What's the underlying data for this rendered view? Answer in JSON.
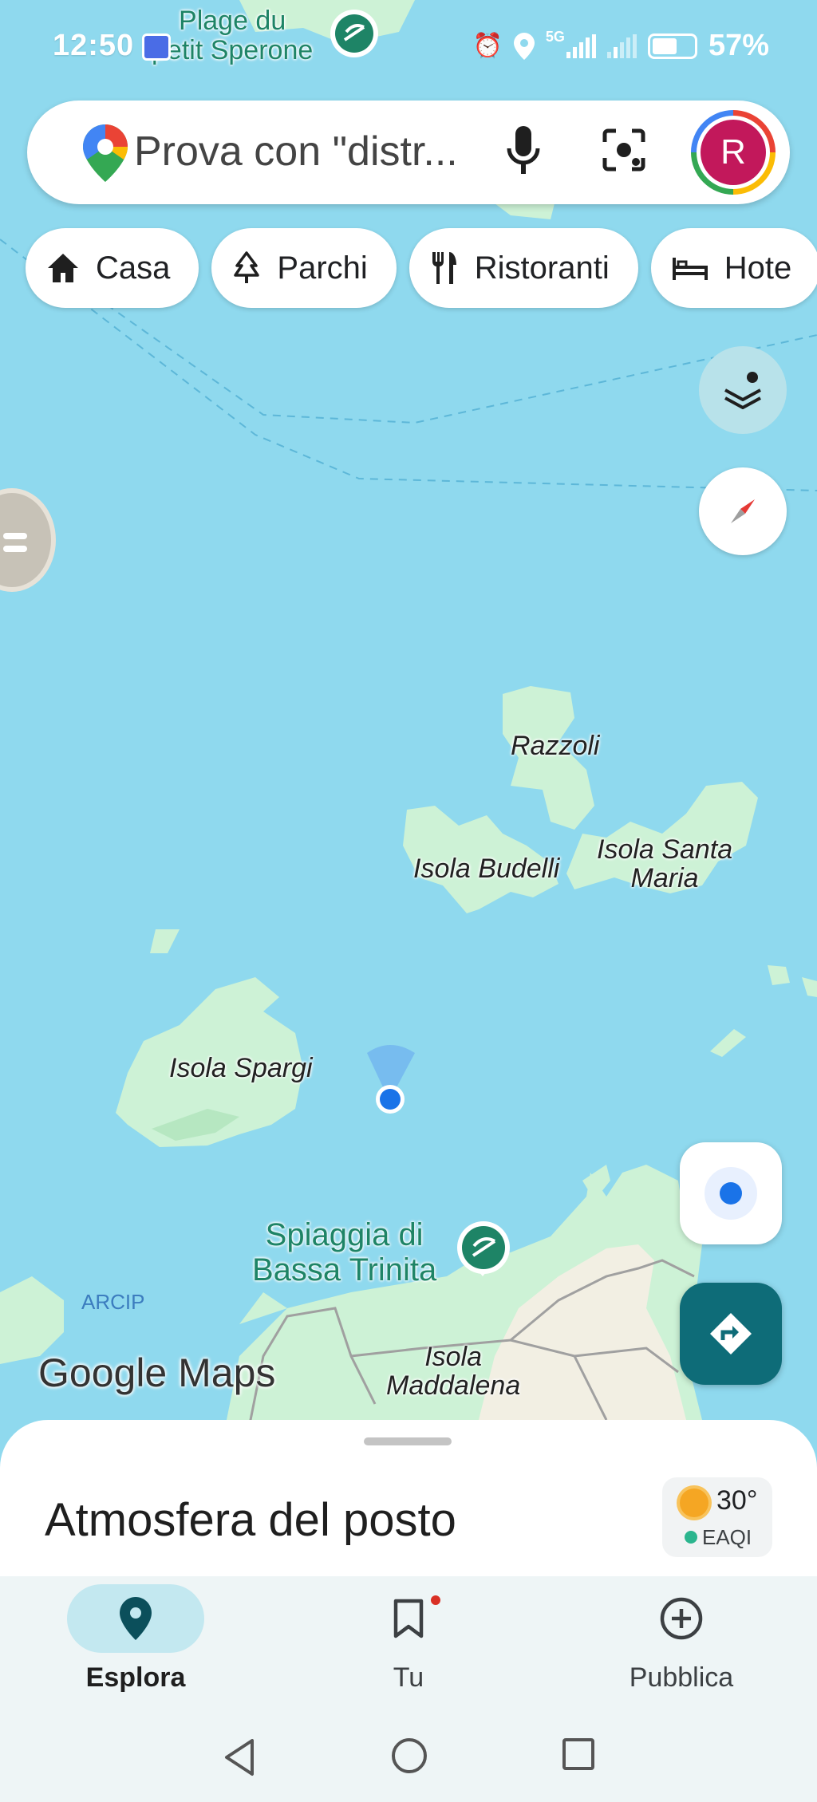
{
  "status_bar": {
    "time": "12:50",
    "network": "5G",
    "battery": "57%",
    "icons": [
      "app-notification-icon",
      "alarm-icon",
      "location-icon",
      "signal-icon",
      "battery-icon"
    ]
  },
  "search": {
    "placeholder": "Prova con \"distr...",
    "avatar_initial": "R",
    "icons": [
      "maps-pin-icon",
      "mic-icon",
      "lens-icon"
    ]
  },
  "chips": [
    {
      "label": "Casa",
      "icon": "home-icon"
    },
    {
      "label": "Parchi",
      "icon": "tree-icon"
    },
    {
      "label": "Ristoranti",
      "icon": "fork-knife-icon"
    },
    {
      "label": "Hote",
      "icon": "bed-icon"
    }
  ],
  "map": {
    "labels": {
      "top_poi": "Plage du\npetit Sperone",
      "razzoli": "Razzoli",
      "budelli": "Isola Budelli",
      "santa_maria": "Isola Santa\nMaria",
      "spargi": "Isola Spargi",
      "bassa_trinita": "Spiaggia di\nBassa Trinita",
      "maddalena": "Isola\nMaddalena",
      "archipelago": "ARCIP"
    },
    "logo": "Google Maps",
    "colors": {
      "water": "#8fd9ee",
      "land": "#cdf2d6",
      "urban": "#f2efe3",
      "poi_green": "#1e8466",
      "my_location": "#1a73e8"
    }
  },
  "sheet": {
    "title": "Atmosfera del posto",
    "weather": {
      "temp": "30°",
      "aqi": "EAQI"
    }
  },
  "nav": [
    {
      "label": "Esplora",
      "icon": "explore-pin-icon",
      "active": true
    },
    {
      "label": "Tu",
      "icon": "bookmark-icon",
      "active": false
    },
    {
      "label": "Pubblica",
      "icon": "add-circle-icon",
      "active": false
    }
  ],
  "system_nav": [
    "back-icon",
    "home-icon",
    "recents-icon"
  ]
}
